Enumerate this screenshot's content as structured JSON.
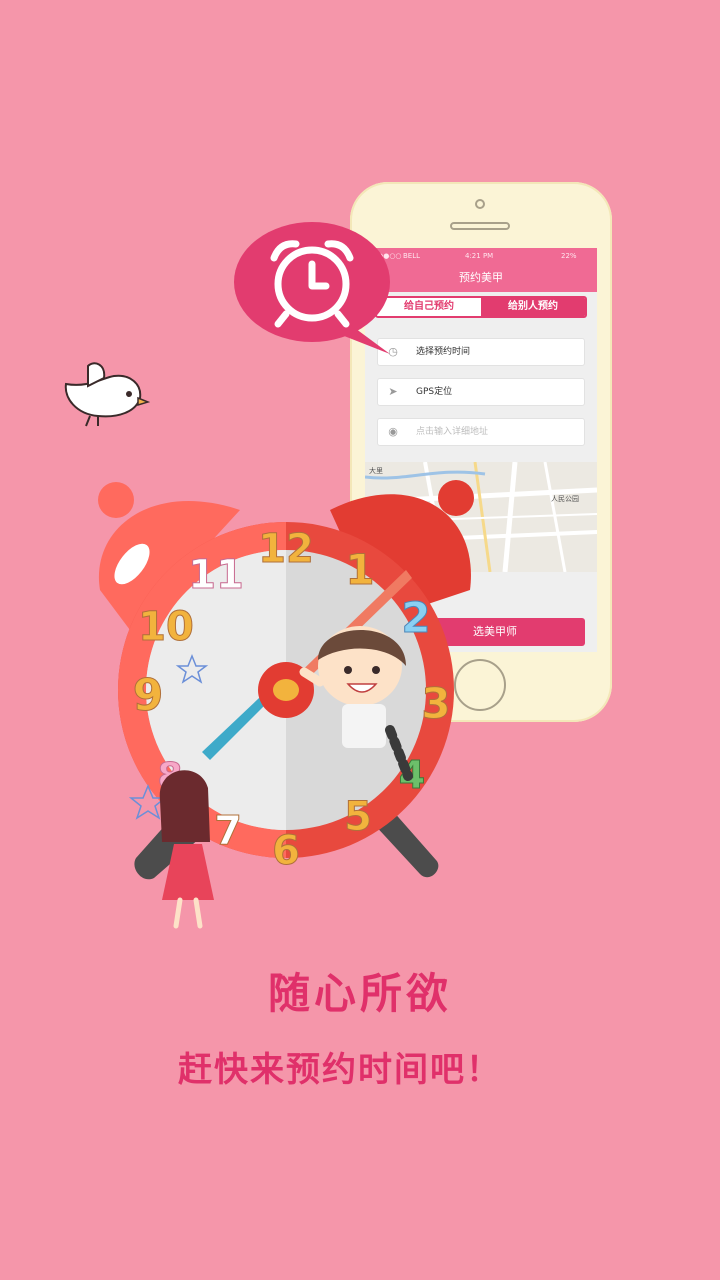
{
  "phone": {
    "status": {
      "carrier": "BELL",
      "time": "4:21 PM",
      "battery": "22%"
    },
    "title": "预约美甲",
    "tabs": [
      {
        "label": "给自己预约",
        "active": true
      },
      {
        "label": "给别人预约",
        "active": false
      }
    ],
    "fields": [
      {
        "icon": "clock-icon",
        "text": "选择预约时间"
      },
      {
        "icon": "location-arrow-icon",
        "text": "GPS定位"
      },
      {
        "icon": "map-pin-icon",
        "placeholder": "点击输入详细地址"
      }
    ],
    "map_labels": [
      "大里",
      "人民公园"
    ],
    "cta": "选美甲师"
  },
  "clock_numbers": [
    "12",
    "1",
    "2",
    "3",
    "4",
    "5",
    "6",
    "7",
    "8",
    "9",
    "10",
    "11"
  ],
  "headline": "随心所欲",
  "subline": "赶快来预约时间吧！",
  "colors": {
    "background": "#f596aa",
    "accent": "#e0306a",
    "clock_red": "#e44a3a",
    "clock_face": "#e8e8e8"
  }
}
